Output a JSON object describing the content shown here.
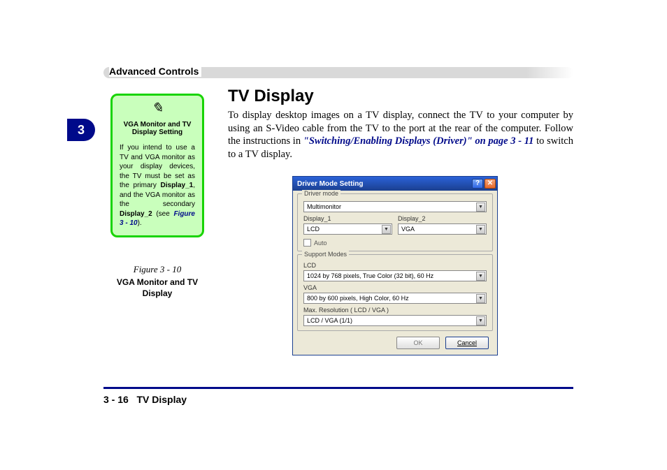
{
  "header": {
    "section": "Advanced Controls"
  },
  "chapter_tab": "3",
  "note": {
    "icon": "✎",
    "title": "VGA Monitor and TV Display Setting",
    "body_pre": "If you intend to use a TV and VGA monitor as your display devices, the TV must be set as the primary ",
    "b1": "Display_1",
    "mid1": ", and the VGA monitor as the secondary ",
    "b2": "Display_2",
    "body_post": " (see ",
    "figref": "Figure 3 - 10",
    "close": ")."
  },
  "figure": {
    "label": "Figure 3 - 10",
    "caption": "VGA Monitor and TV Display"
  },
  "main": {
    "heading": "TV Display",
    "para_pre": "To display desktop images on a TV display, connect the TV to your computer by using an S-Video cable from the TV to the port at the rear of the computer. Follow the instructions in ",
    "crossref": "\"Switching/Enabling Displays (Driver)\" on page 3 - 11",
    "para_post": " to switch to a TV display."
  },
  "dialog": {
    "title": "Driver Mode Setting",
    "help": "?",
    "close": "✕",
    "group_driver": "Driver mode",
    "driver_mode": "Multimonitor",
    "display1_label": "Display_1",
    "display1_value": "LCD",
    "display2_label": "Display_2",
    "display2_value": "VGA",
    "auto_label": "Auto",
    "group_support": "Support Modes",
    "lcd_label": "LCD",
    "lcd_mode": "1024 by 768 pixels, True Color (32 bit), 60 Hz",
    "vga_label": "VGA",
    "vga_mode": "800 by 600 pixels, High Color, 60 Hz",
    "maxres_label": "Max. Resolution ( LCD   / VGA  )",
    "maxres_value": "LCD   / VGA  (1/1)",
    "ok": "OK",
    "cancel": "Cancel"
  },
  "footer": {
    "page": "3  -  16",
    "title": "TV Display"
  }
}
